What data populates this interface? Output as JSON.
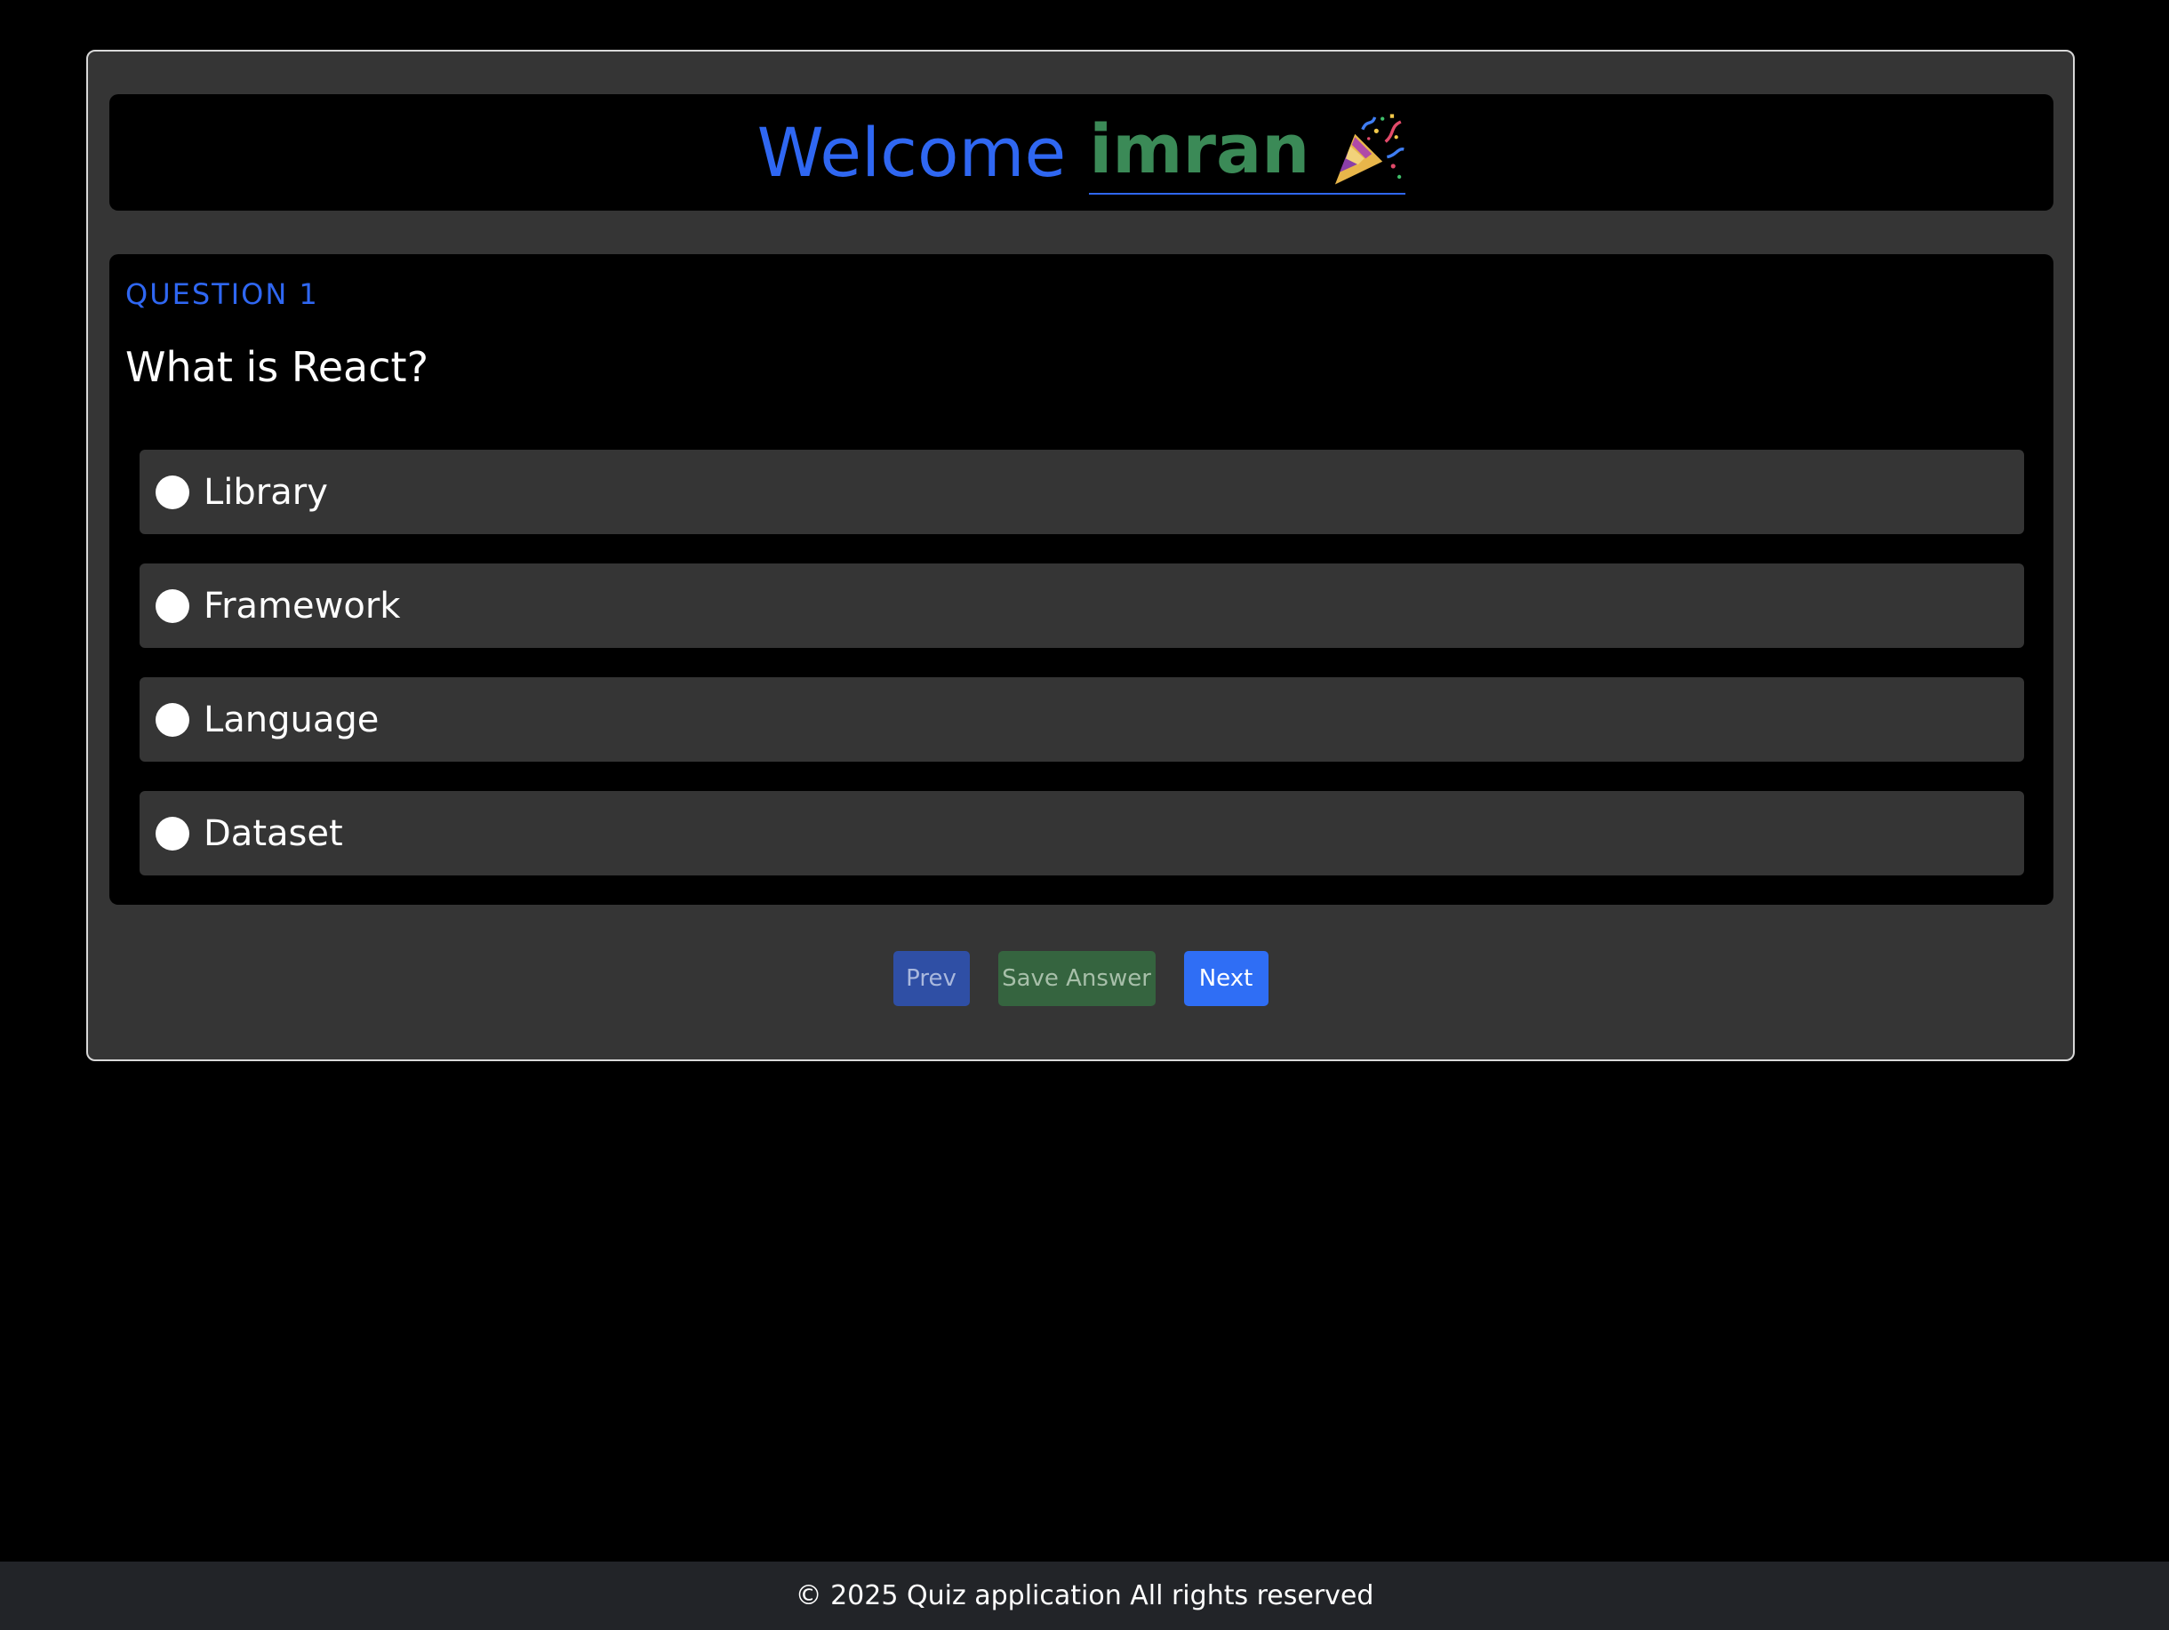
{
  "header": {
    "welcome_text": "Welcome",
    "user_name": "imran",
    "celebration_icon": "party-popper-icon"
  },
  "question": {
    "number_label": "QUESTION 1",
    "text": "What is React?",
    "options": [
      {
        "label": "Library"
      },
      {
        "label": "Framework"
      },
      {
        "label": "Language"
      },
      {
        "label": "Dataset"
      }
    ]
  },
  "actions": {
    "prev_label": "Prev",
    "save_label": "Save Answer",
    "next_label": "Next"
  },
  "footer": {
    "text": "© 2025 Quiz application All rights reserved"
  },
  "colors": {
    "accent_blue": "#2f67f2",
    "accent_green": "#3b8a57",
    "card_background": "#353535",
    "page_background": "#000000",
    "footer_background": "#222428"
  }
}
